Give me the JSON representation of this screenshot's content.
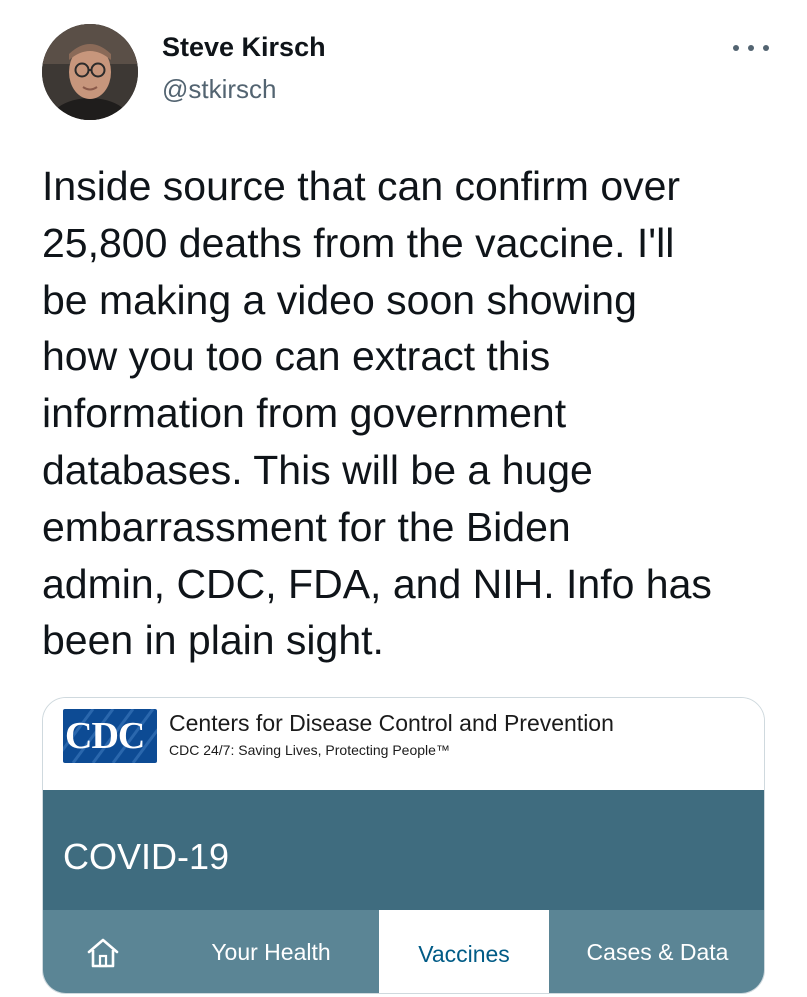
{
  "author": {
    "name": "Steve Kirsch",
    "handle": "@stkirsch"
  },
  "tweet": {
    "text_lines": [
      "Inside source that can confirm over",
      "25,800 deaths from the vaccine. I'll",
      "be making a video soon showing",
      "how you too can extract this",
      "information from government",
      "databases. This will be a huge",
      "embarrassment for the Biden",
      "admin, CDC, FDA, and NIH. Info has",
      "been in plain sight."
    ]
  },
  "icons": {
    "more": "more-horizontal-icon",
    "home": "home-icon"
  },
  "media": {
    "logo_text": "CDC",
    "title": "Centers for Disease Control and Prevention",
    "tagline": "CDC 24/7: Saving Lives, Protecting People™",
    "banner_title": "COVID-19",
    "nav": {
      "your_health": "Your Health",
      "vaccines": "Vaccines",
      "cases_data": "Cases & Data"
    }
  },
  "colors": {
    "cdc_blue": "#0d4b94",
    "banner_teal": "#3f6c7f",
    "nav_teal": "#5b8595",
    "active_tab_text": "#005b86",
    "handle_gray": "#536471"
  }
}
